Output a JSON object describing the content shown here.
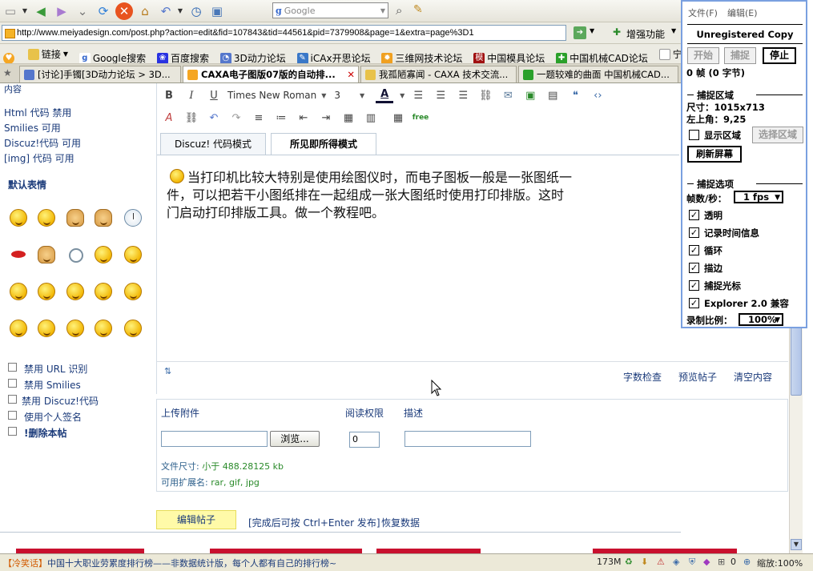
{
  "browser": {
    "search_placeholder": "Google",
    "address": "http://www.meiyadesign.com/post.php?action=edit&fid=107843&tid=44561&pid=7379908&page=1&extra=page%3D1",
    "enhance_label": "增强功能",
    "bookmarks": [
      "链接",
      "Google搜索",
      "百度搜索",
      "3D动力论坛",
      "iCAx开思论坛",
      "三维网技术论坛",
      "中国模具论坛",
      "中国机械CAD论坛",
      "宁夏职业技术学"
    ],
    "tabs": [
      "[讨论]手镯[3D动力论坛 > 3D...",
      "CAXA电子图版07版的自动排...",
      "我孤陋寡闻 - CAXA 技术交流...",
      "一题较难的曲面 中国机械CAD..."
    ]
  },
  "left": {
    "top_cut": "内容",
    "perms": [
      "Html 代码 禁用",
      "Smilies 可用",
      "Discuz!代码 可用",
      "[img] 代码 可用"
    ],
    "emoticon_title": "默认表情",
    "emoticons": [
      "smile",
      "grin",
      "hug",
      "victory",
      "clock",
      "lips",
      "handshake",
      "snail",
      "wink",
      "sweat",
      "angry",
      "pout",
      "cool",
      "cry",
      "ban",
      "shy",
      "happy",
      "tongue",
      "laugh",
      "shocked"
    ],
    "options": [
      "禁用 URL 识别",
      "禁用 Smilies",
      "禁用 Discuz!代码",
      "使用个人签名",
      "!删除本帖"
    ]
  },
  "editor": {
    "font": "Times New Roman",
    "size": "3",
    "mode_tabs": [
      "Discuz! 代码模式",
      "所见即所得模式"
    ],
    "content_line1": "当打印机比较大特别是使用绘图仪时，而电子图板一般是一张图纸一",
    "content_line2": "件，可以把若干小图纸排在一起组成一张大图纸时使用打印排版。这时",
    "content_line3": "门启动打印排版工具。做一个教程吧。",
    "bottom_links": [
      "字数检查",
      "预览帖子",
      "清空内容"
    ]
  },
  "attach": {
    "h_upload": "上传附件",
    "h_perm": "阅读权限",
    "h_desc": "描述",
    "browse": "浏览...",
    "perm_value": "0",
    "size_label": "文件尺寸: ",
    "size_value": "小于 488.28125 kb",
    "ext_label": "可用扩展名: ",
    "ext_value": "rar, gif, jpg"
  },
  "submit": {
    "button": "编辑帖子",
    "hint": "[完成后可按 Ctrl+Enter 发布]",
    "restore": "恢复数据"
  },
  "status": {
    "prefix": "【冷笑话】",
    "text": "中国十大职业劳累度排行榜——非数据统计版，每个人都有自己的排行榜~",
    "mem": "173M",
    "count": "0",
    "zoom": "缩放:100%"
  },
  "capture": {
    "menu_file": "文件(F)",
    "menu_edit": "编辑(E)",
    "title": "Unregistered Copy",
    "btn_start": "开始",
    "btn_capture": "捕捉",
    "btn_stop": "停止",
    "frames": "0 帧 (0 字节)",
    "sec_region": "捕捉区域",
    "size": "尺寸：1015x713",
    "topleft": "左上角：9,25",
    "show_region": "显示区域",
    "select_region": "选择区域",
    "refresh": "刷新屏幕",
    "sec_options": "捕捉选项",
    "fps_label": "帧数/秒：",
    "fps_value": "1 fps",
    "opts": [
      "透明",
      "记录时间信息",
      "循环",
      "描边",
      "捕捉光标",
      "Explorer 2.0 兼容"
    ],
    "scale_label": "录制比例：",
    "scale_value": "100%"
  }
}
